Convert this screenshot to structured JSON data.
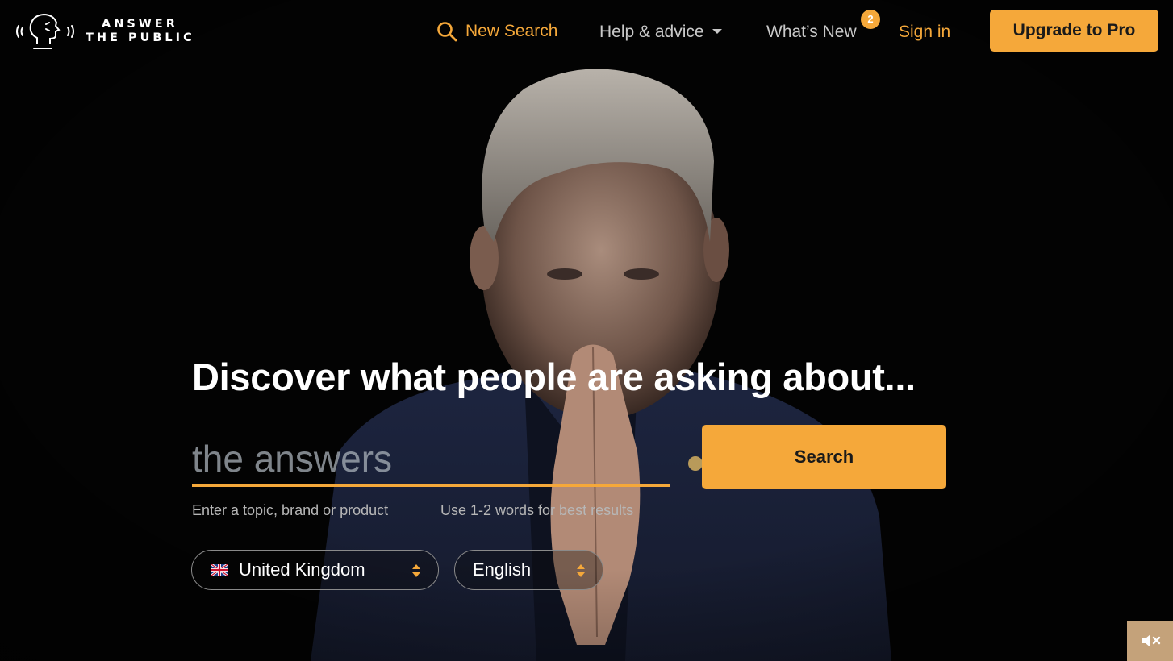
{
  "brand": {
    "logo_line1": "ANSWER",
    "logo_line2": "THE PUBLIC",
    "accent_color": "#f5a83a"
  },
  "nav": {
    "new_search": "New Search",
    "help": "Help & advice",
    "whats_new": "What’s New",
    "whats_new_badge": "2",
    "sign_in": "Sign in",
    "upgrade": "Upgrade to Pro"
  },
  "hero": {
    "headline": "Discover what people are asking about...",
    "search_placeholder": "the answers",
    "search_button": "Search",
    "hint_topic": "Enter a topic, brand or product",
    "hint_words": "Use 1-2 words for best results",
    "country": "United Kingdom",
    "language": "English"
  },
  "icons": {
    "logo": "speaking-head-icon",
    "search": "magnifier-icon",
    "mute": "speaker-muted-icon",
    "country_flag": "uk-flag-icon"
  }
}
